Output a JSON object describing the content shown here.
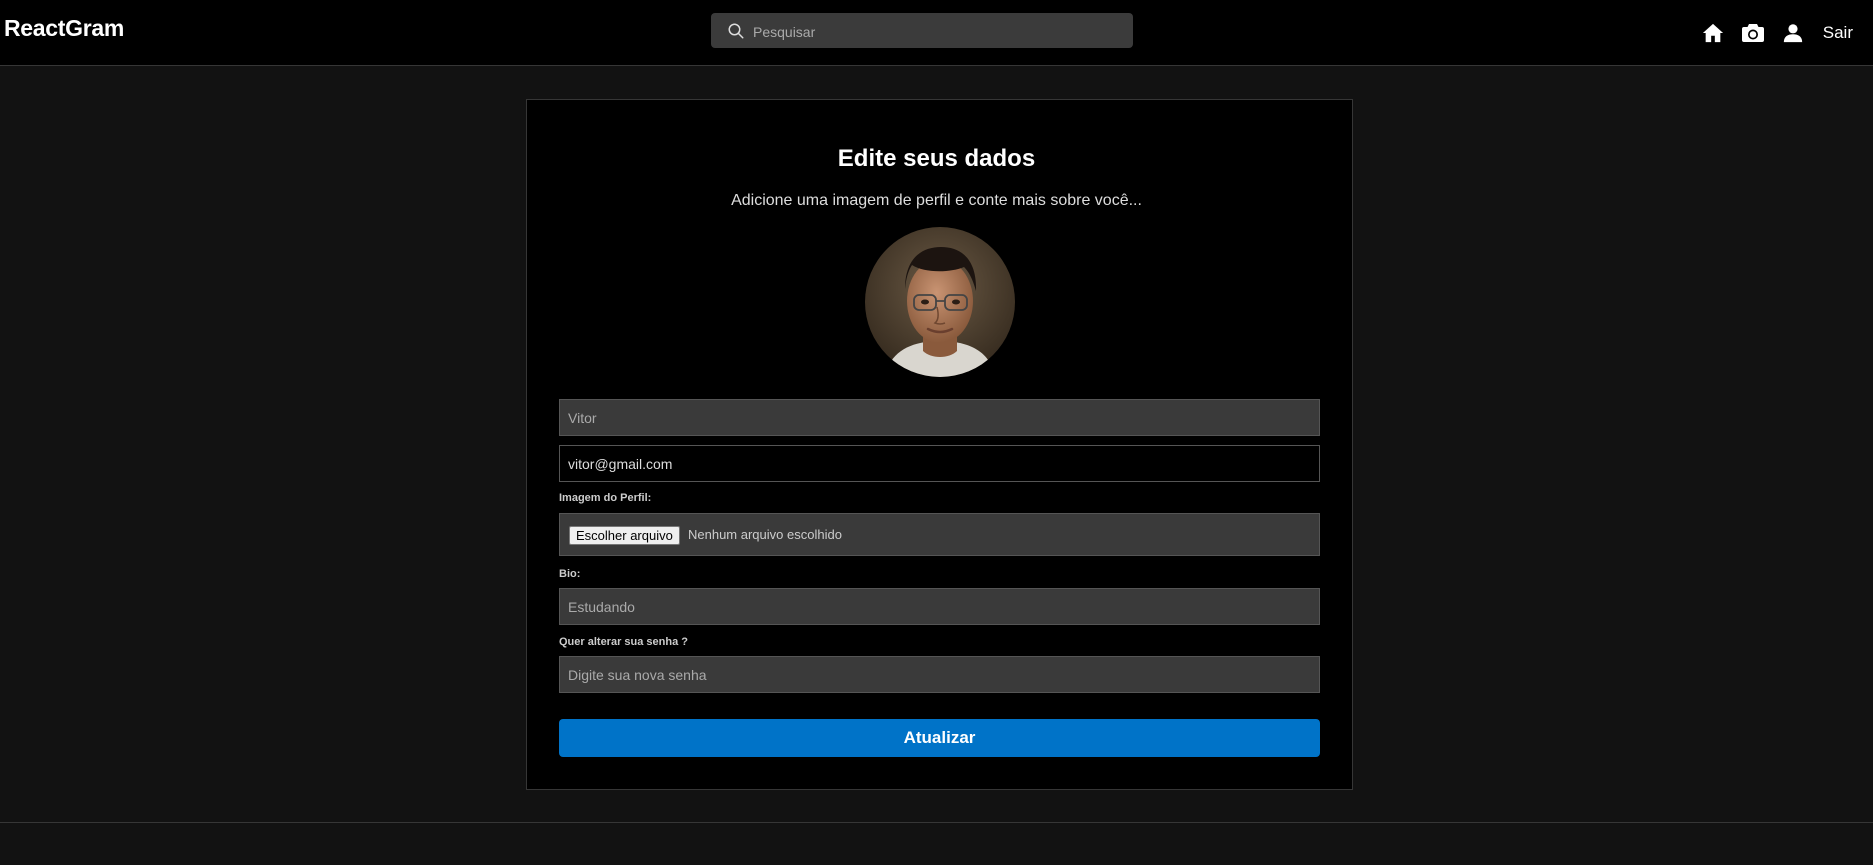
{
  "navbar": {
    "brand": "ReactGram",
    "search_placeholder": "Pesquisar",
    "icons": [
      "home-icon",
      "camera-icon",
      "user-icon"
    ],
    "logout_label": "Sair"
  },
  "edit_profile": {
    "title": "Edite seus dados",
    "subtitle": "Adicione uma imagem de perfil e conte mais sobre você...",
    "name_value": "Vitor",
    "email_value": "vitor@gmail.com",
    "image_label": "Imagem do Perfil:",
    "file_button_label": "Escolher arquivo",
    "file_status": "Nenhum arquivo escolhido",
    "bio_label": "Bio:",
    "bio_value": "Estudando",
    "password_label": "Quer alterar sua senha ?",
    "password_placeholder": "Digite sua nova senha",
    "submit_label": "Atualizar"
  },
  "colors": {
    "page_bg": "#121212",
    "card_bg": "#000000",
    "input_bg": "#3a3a3a",
    "accent": "#0073c8"
  }
}
